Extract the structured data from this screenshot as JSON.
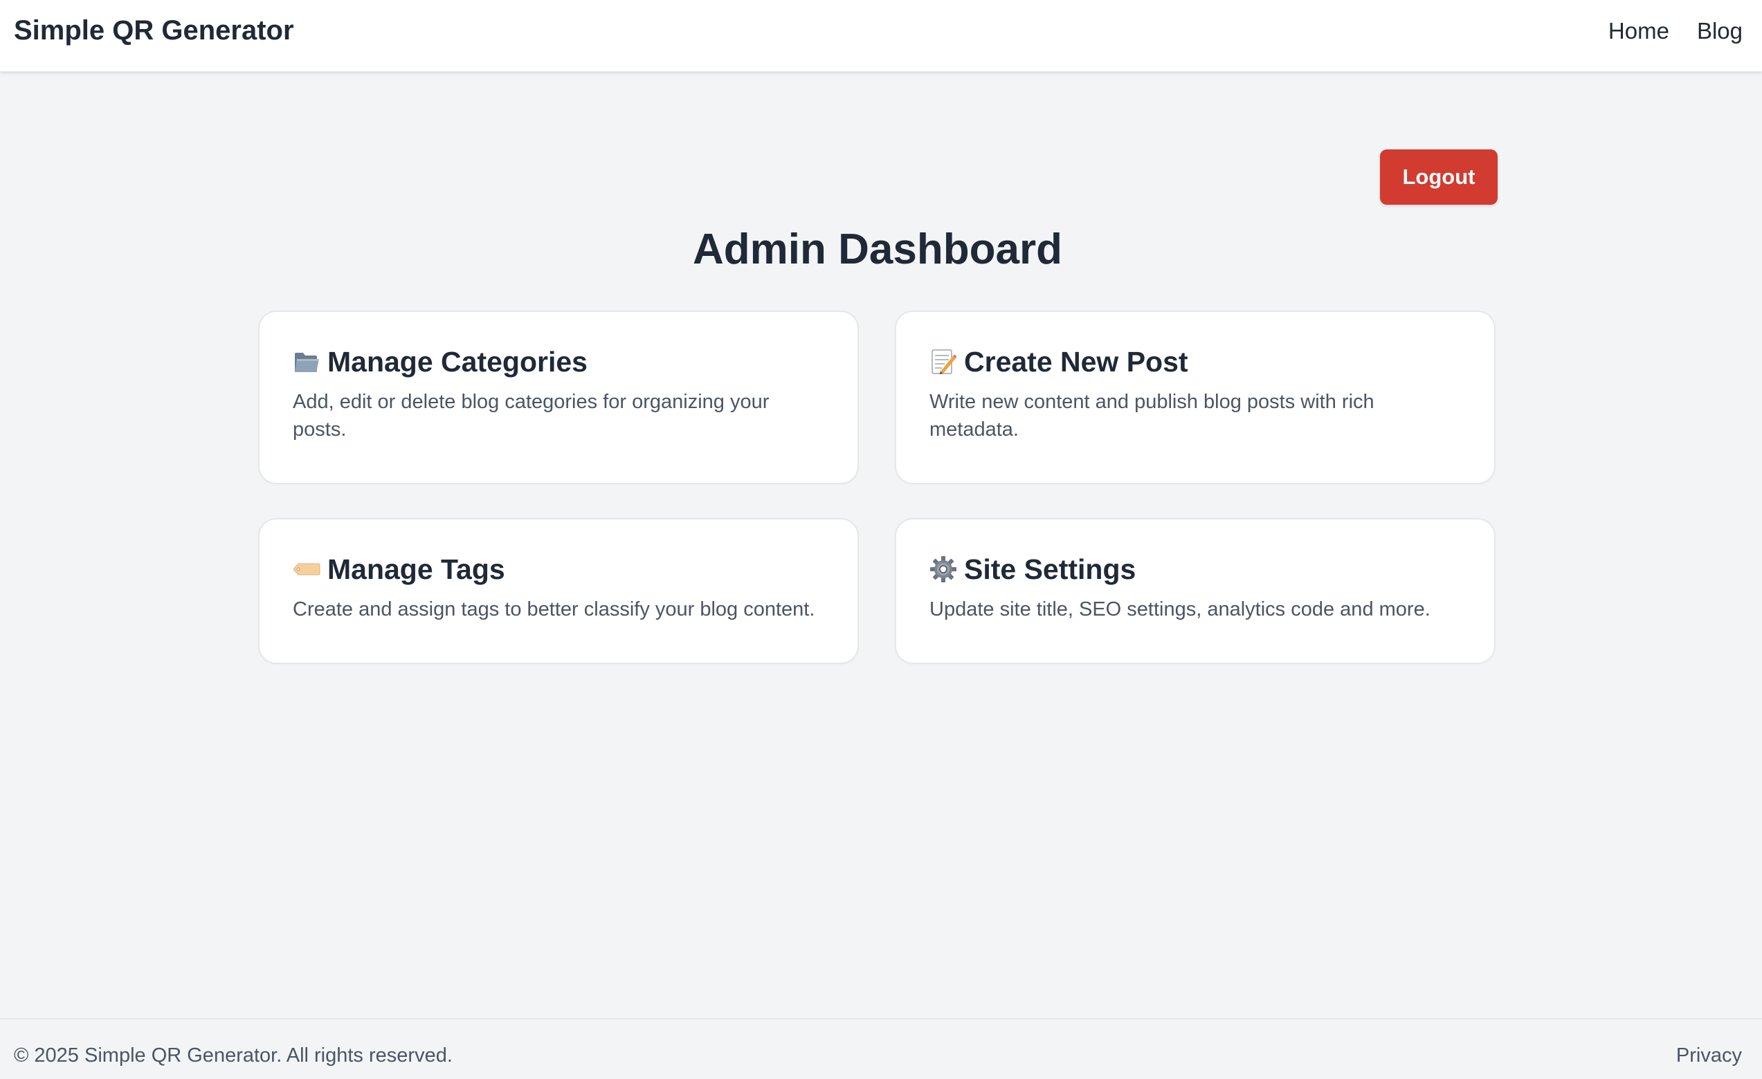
{
  "header": {
    "brand": "Simple QR Generator",
    "nav": [
      {
        "label": "Home"
      },
      {
        "label": "Blog"
      }
    ]
  },
  "logout_label": "Logout",
  "accent_colors": {
    "logout": "#d13b30",
    "background": "#f3f4f6",
    "text": "#1f2937"
  },
  "page_title": "Admin Dashboard",
  "cards": [
    {
      "icon": "folder-icon",
      "title": "Manage Categories",
      "description": "Add, edit or delete blog categories for organizing your posts."
    },
    {
      "icon": "memo-icon",
      "title": "Create New Post",
      "description": "Write new content and publish blog posts with rich metadata."
    },
    {
      "icon": "tag-icon",
      "title": "Manage Tags",
      "description": "Create and assign tags to better classify your blog content."
    },
    {
      "icon": "gear-icon",
      "title": "Site Settings",
      "description": "Update site title, SEO settings, analytics code and more."
    }
  ],
  "footer": {
    "copyright": "© 2025 Simple QR Generator. All rights reserved.",
    "privacy": "Privacy"
  }
}
